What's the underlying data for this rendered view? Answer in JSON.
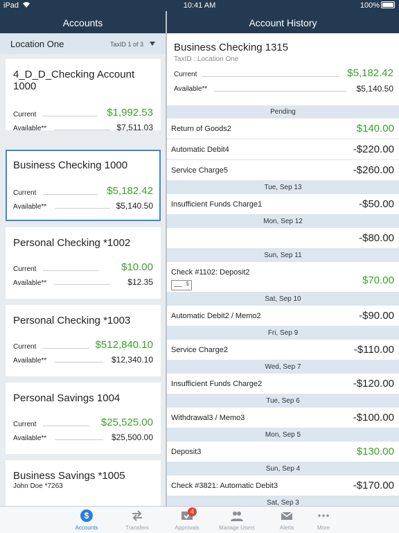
{
  "status": {
    "carrier": "iPad",
    "time": "10:41 AM",
    "battery": "100%"
  },
  "nav": {
    "left_title": "Accounts",
    "right_title": "Account History"
  },
  "location": {
    "name": "Location One",
    "taxid": "TaxID 1 of 3"
  },
  "accounts": [
    {
      "name": "4_D_D_Checking Account 1000",
      "current_label": "Current",
      "current": "$1,992.53",
      "available_label": "Available**",
      "available": "$7,511.03"
    },
    {
      "name": "Business Checking 1000",
      "current_label": "Current",
      "current": "$5,182.42",
      "available_label": "Available**",
      "available": "$5,140.50",
      "selected": true
    },
    {
      "name": "Personal Checking *1002",
      "current_label": "Current",
      "current": "$10.00",
      "available_label": "Available**",
      "available": "$12.35"
    },
    {
      "name": "Personal Checking *1003",
      "current_label": "Current",
      "current": "$512,840.10",
      "available_label": "Available**",
      "available": "$12,340.10"
    },
    {
      "name": "Personal Savings 1004",
      "current_label": "Current",
      "current": "$25,525.00",
      "available_label": "Available**",
      "available": "$25,500.00"
    },
    {
      "name": "Business Savings *1005",
      "sub": "John Doe *7263"
    }
  ],
  "history": {
    "account": "Business Checking 1315",
    "taxid": "TaxID : Location One",
    "current_label": "Current",
    "current": "$5,182.42",
    "available_label": "Available**",
    "available": "$5,140.50"
  },
  "transactions": [
    {
      "section": "Pending"
    },
    {
      "desc": "Return of Goods2",
      "amount": "$140.00",
      "sign": "pos"
    },
    {
      "desc": "Automatic Debit4",
      "amount": "-$220.00",
      "sign": "neg"
    },
    {
      "desc": "Service Charge5",
      "amount": "-$260.00",
      "sign": "neg"
    },
    {
      "section": "Tue, Sep 13"
    },
    {
      "desc": "Insufficient Funds Charge1",
      "amount": "-$50.00",
      "sign": "neg"
    },
    {
      "section": "Mon, Sep 12"
    },
    {
      "desc": "",
      "amount": "-$80.00",
      "sign": "neg"
    },
    {
      "section": "Sun, Sep 11"
    },
    {
      "desc": "Check #1102: Deposit2",
      "amount": "$70.00",
      "sign": "pos",
      "check": true
    },
    {
      "section": "Sat, Sep 10"
    },
    {
      "desc": "Automatic Debit2 / Memo2",
      "amount": "-$90.00",
      "sign": "neg"
    },
    {
      "section": "Fri, Sep 9"
    },
    {
      "desc": "Service Charge2",
      "amount": "-$110.00",
      "sign": "neg"
    },
    {
      "section": "Wed, Sep 7"
    },
    {
      "desc": "Insufficient Funds Charge2",
      "amount": "-$120.00",
      "sign": "neg"
    },
    {
      "section": "Tue, Sep 6"
    },
    {
      "desc": "Withdrawal3 / Memo3",
      "amount": "-$100.00",
      "sign": "neg"
    },
    {
      "section": "Mon, Sep 5"
    },
    {
      "desc": "Deposit3",
      "amount": "$130.00",
      "sign": "pos"
    },
    {
      "section": "Sun, Sep 4"
    },
    {
      "desc": "Check #3821: Automatic Debit3",
      "amount": "-$170.00",
      "sign": "neg"
    },
    {
      "section": "Sat, Sep 3"
    }
  ],
  "tabs": [
    {
      "label": "Accounts",
      "icon": "dollar-icon",
      "active": true
    },
    {
      "label": "Transfers",
      "icon": "transfer-icon"
    },
    {
      "label": "Approvals",
      "icon": "approval-icon",
      "badge": "4"
    },
    {
      "label": "Manage Users",
      "icon": "users-icon"
    },
    {
      "label": "Alerts",
      "icon": "mail-icon"
    },
    {
      "label": "More",
      "icon": "more-icon"
    }
  ],
  "colors": {
    "nav": "#243a52",
    "green": "#3aa02b",
    "accent": "#2a7fd6",
    "section": "#dbe6ef"
  }
}
